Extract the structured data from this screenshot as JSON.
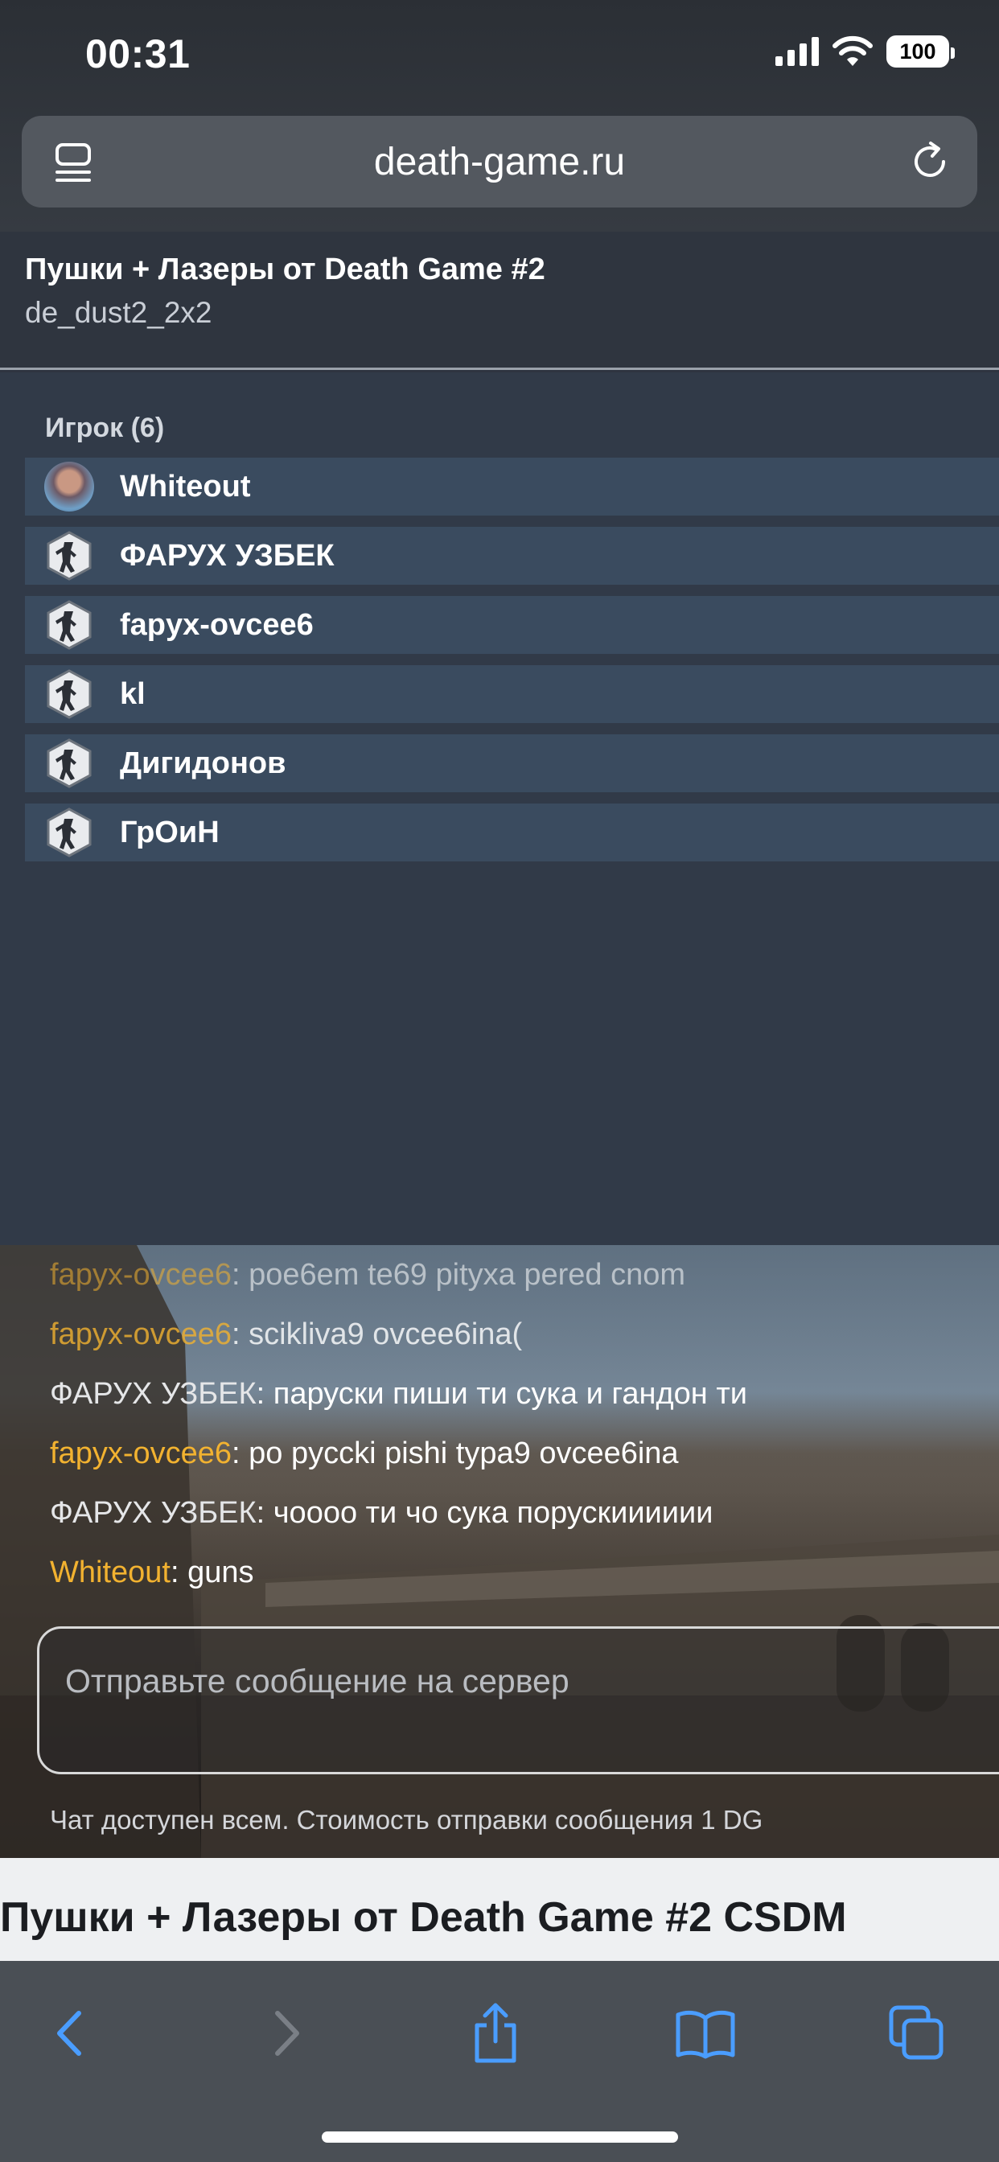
{
  "status_bar": {
    "time": "00:31",
    "battery": "100",
    "icons": [
      "signal-icon",
      "wifi-icon",
      "battery-icon"
    ]
  },
  "browser": {
    "url": "death-game.ru",
    "icons": [
      "reader-mode-icon",
      "reload-icon"
    ]
  },
  "server": {
    "title": "Пушки + Лазеры от Death Game #2",
    "map": "de_dust2_2x2"
  },
  "players": {
    "header": "Игрок (6)",
    "items": [
      {
        "name": "Whiteout",
        "avatar": "photo"
      },
      {
        "name": "ФАРУХ УЗБЕК",
        "avatar": "cs-logo-icon"
      },
      {
        "name": "fapyx-ovcee6",
        "avatar": "cs-logo-icon"
      },
      {
        "name": "kl",
        "avatar": "cs-logo-icon"
      },
      {
        "name": "Дигидонов",
        "avatar": "cs-logo-icon"
      },
      {
        "name": "ГрОиН",
        "avatar": "cs-logo-icon"
      }
    ]
  },
  "chat": {
    "messages": [
      {
        "nick": "fapyx-ovcee6",
        "text": ": poe6em te69 pityxa pered cnom",
        "nick_color": "gold"
      },
      {
        "nick": "fapyx-ovcee6",
        "text": ": scikliva9 ovcee6ina(",
        "nick_color": "gold"
      },
      {
        "nick": "ФАРУХ УЗБЕК",
        "text": ": паруски пиши ти сука и гандон ти",
        "nick_color": "plain"
      },
      {
        "nick": "fapyx-ovcee6",
        "text": ": po pyccki pishi typa9 ovcee6ina",
        "nick_color": "gold"
      },
      {
        "nick": "ФАРУХ УЗБЕК",
        "text": ": чоооо ти чо сука порускииииии",
        "nick_color": "plain"
      },
      {
        "nick": "Whiteout",
        "text": ": guns",
        "nick_color": "gold"
      }
    ],
    "input_placeholder": "Отправьте сообщение на сервер",
    "hint": "Чат доступен всем. Стоимость отправки сообщения 1 DG"
  },
  "page": {
    "heading": "Пушки + Лазеры от Death Game #2 CSDM"
  },
  "toolbar": {
    "items": [
      "back-icon",
      "forward-icon",
      "share-icon",
      "bookmarks-icon",
      "tabs-icon"
    ]
  },
  "colors": {
    "accent_nick": "#f2b230",
    "player_row": "#3a4b5f",
    "panel_bg": "#313a48"
  }
}
